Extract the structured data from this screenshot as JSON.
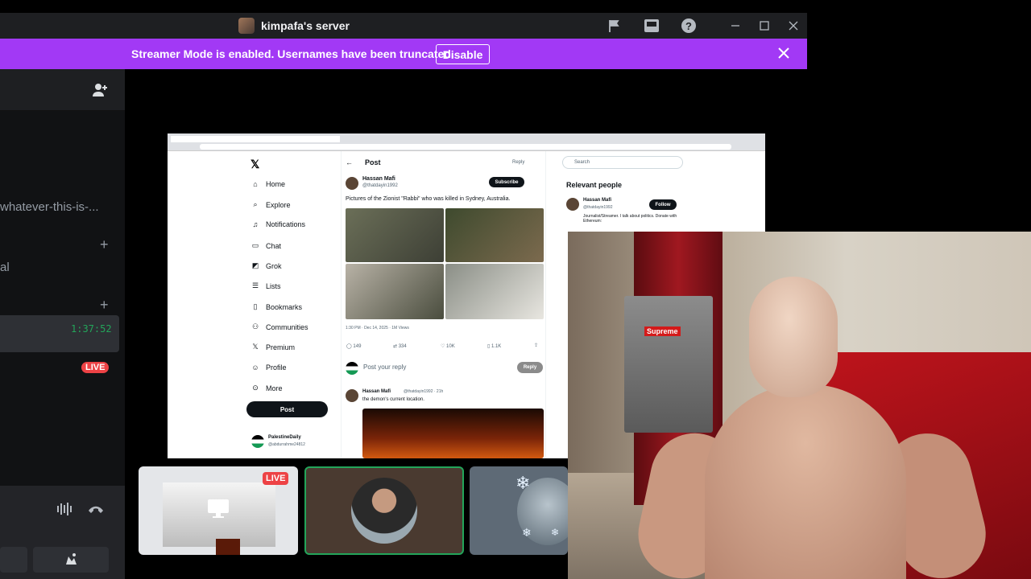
{
  "titlebar": {
    "title": "kimpafa's server"
  },
  "banner": {
    "text": "Streamer Mode is enabled. Usernames have been truncated.",
    "button": "Disable"
  },
  "sidebar": {
    "channel_fragment": "whatever-this-is-...",
    "channel_fragment_2": "al",
    "timer": "1:37:52",
    "live_label": "LIVE"
  },
  "screenshare": {
    "nav": [
      "Home",
      "Explore",
      "Notifications",
      "Chat",
      "Grok",
      "Lists",
      "Bookmarks",
      "Communities",
      "Premium",
      "Profile",
      "More"
    ],
    "post_button": "Post",
    "header": "Post",
    "header_reply": "Reply",
    "author": "Hassan Mafi",
    "handle": "@thatdayin1992",
    "subscribe": "Subscribe",
    "tweet_text": "Pictures of the Zionist \"Rabbi\" who was killed in Sydney, Australia.",
    "timestamp": "1:30 PM · Dec 14, 2025 · 1M Views",
    "stats": [
      "149",
      "334",
      "10K",
      "1.1K"
    ],
    "reply_placeholder": "Post your reply",
    "reply_button": "Reply",
    "reply_author": "Hassan Mafi",
    "reply_handle": "@thatdayin1992 · 21h",
    "reply_text": "the demon's current location.",
    "account_name": "PalestineDaily",
    "account_handle": "@abdurrahme24812",
    "search_placeholder": "Search",
    "relevant_title": "Relevant people",
    "follow": "Follow",
    "bio": "Journalist/Streamer. I talk about politics. Donate with Ethereum:"
  },
  "thumbnails": {
    "live_label": "LIVE"
  },
  "webcam": {
    "sticker": "Supreme"
  },
  "colors": {
    "banner": "#a239f5",
    "live": "#ed4245",
    "speaking": "#23a55a"
  }
}
